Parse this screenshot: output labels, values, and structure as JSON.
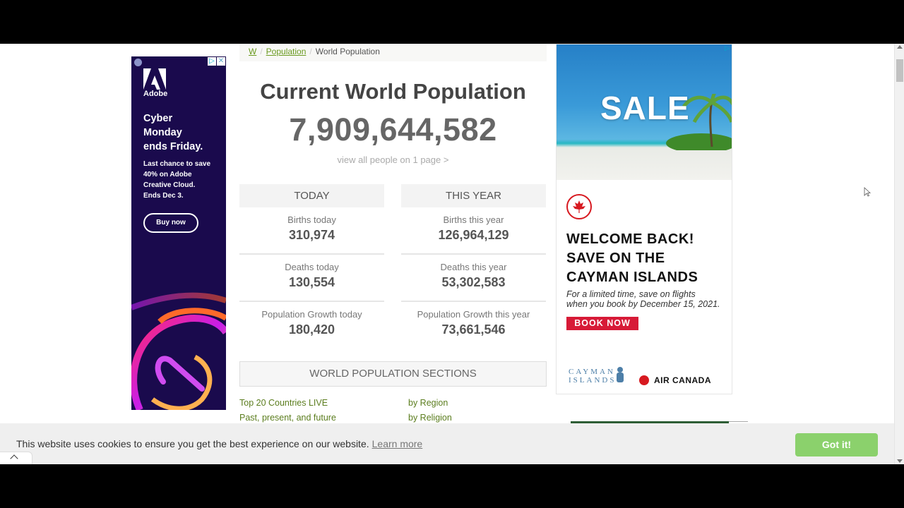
{
  "breadcrumb": {
    "items": [
      "W",
      "Population"
    ],
    "current": "World Population",
    "separator": "/"
  },
  "main": {
    "title": "Current World Population",
    "counter": "7,909,644,582",
    "view_all": "view all people on 1 page >",
    "today": {
      "header": "TODAY",
      "stats": [
        {
          "label": "Births today",
          "value": "310,974"
        },
        {
          "label": "Deaths today",
          "value": "130,554"
        },
        {
          "label": "Population Growth today",
          "value": "180,420"
        }
      ]
    },
    "this_year": {
      "header": "THIS YEAR",
      "stats": [
        {
          "label": "Births this year",
          "value": "126,964,129"
        },
        {
          "label": "Deaths this year",
          "value": "53,302,583"
        },
        {
          "label": "Population Growth this year",
          "value": "73,661,546"
        }
      ]
    },
    "sections": {
      "header": "WORLD POPULATION SECTIONS",
      "links": [
        "Top 20 Countries LIVE",
        "by Region",
        "Past, present, and future",
        "by Religion"
      ]
    }
  },
  "ad_left": {
    "brand": "Adobe",
    "headline_1": "Cyber",
    "headline_2": "Monday",
    "headline_3": "ends Friday.",
    "body_1": "Last chance to save",
    "body_2": "40% on Adobe",
    "body_3": "Creative Cloud.",
    "body_4": "Ends Dec 3.",
    "cta": "Buy now",
    "adchoices_icon": "▷",
    "close_icon": "✕"
  },
  "ad_right": {
    "sale": "SALE",
    "headline_1": "WELCOME BACK!",
    "headline_2": "SAVE ON THE",
    "headline_3": "CAYMAN ISLANDS",
    "fine_1": "For a limited time, save on flights",
    "fine_2": "when you book by December 15, 2021.",
    "cta": "BOOK NOW",
    "partner_1a": "CAYMAN",
    "partner_1b": "ISLANDS",
    "partner_2": "AIR CANADA",
    "adchoices_icon": "▷"
  },
  "cookie": {
    "message": "This website uses cookies to ensure you get the best experience on our website.",
    "learn_more": "Learn more",
    "accept": "Got it!"
  },
  "colors": {
    "link_green": "#6a9a1f",
    "accept_green": "#8bd16c",
    "book_red": "#d71a37",
    "adobe_bg": "#1a0a4d"
  }
}
